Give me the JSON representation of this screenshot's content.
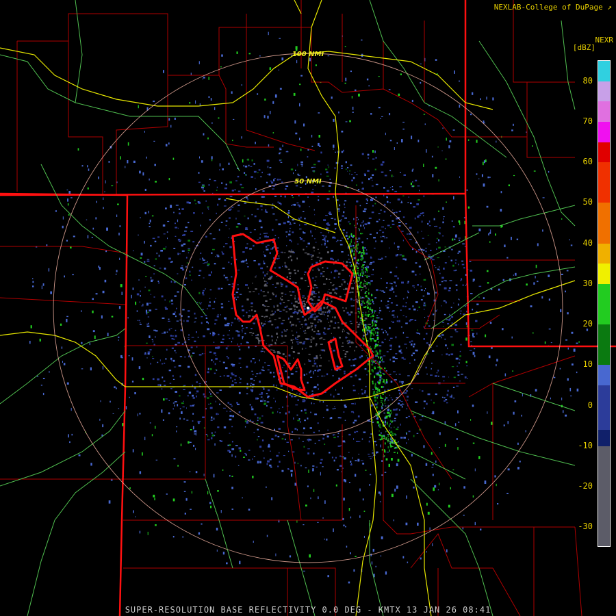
{
  "header": {
    "credit": "NEXLAB-College of DuPage",
    "product": "NEXR",
    "units": "[dBZ]"
  },
  "rings": [
    {
      "label": "100 NMI",
      "nmi": 100
    },
    {
      "label": "50 NMI",
      "nmi": 50
    }
  ],
  "legend": {
    "ticks": [
      "80",
      "70",
      "60",
      "50",
      "40",
      "30",
      "20",
      "10",
      "0",
      "-10",
      "-20",
      "-30"
    ],
    "tick_values": [
      80,
      70,
      60,
      50,
      40,
      30,
      20,
      10,
      0,
      -10,
      -20,
      -30
    ],
    "range_dbz": [
      -35,
      85
    ],
    "segments": [
      {
        "from": -35,
        "to": -10,
        "color": "#5c5c68"
      },
      {
        "from": -10,
        "to": -6,
        "color": "#10206a"
      },
      {
        "from": -6,
        "to": 5,
        "color": "#2c3c9a"
      },
      {
        "from": 5,
        "to": 10,
        "color": "#4868d0"
      },
      {
        "from": 10,
        "to": 20,
        "color": "#0a7a10"
      },
      {
        "from": 20,
        "to": 30,
        "color": "#22cc20"
      },
      {
        "from": 30,
        "to": 35,
        "color": "#f0f000"
      },
      {
        "from": 35,
        "to": 40,
        "color": "#f0b000"
      },
      {
        "from": 40,
        "to": 50,
        "color": "#f07000"
      },
      {
        "from": 50,
        "to": 60,
        "color": "#f03000"
      },
      {
        "from": 60,
        "to": 65,
        "color": "#e00000"
      },
      {
        "from": 65,
        "to": 70,
        "color": "#f010f0"
      },
      {
        "from": 70,
        "to": 75,
        "color": "#e070e0"
      },
      {
        "from": 75,
        "to": 80,
        "color": "#c8a0e8"
      },
      {
        "from": 80,
        "to": 85,
        "color": "#30d0e0"
      }
    ]
  },
  "footer": {
    "caption": "SUPER-RESOLUTION BASE REFLECTIVITY 0.0 DEG - KMTX 13 JAN 26 08:41"
  },
  "colors": {
    "state_border": "#ff1010",
    "county_border": "#b00000",
    "highway": "#e8e800",
    "road": "#50c050",
    "range_ring": "#f0b0a0",
    "warning_polygon": "#ff1010",
    "text": "#e8d000"
  }
}
